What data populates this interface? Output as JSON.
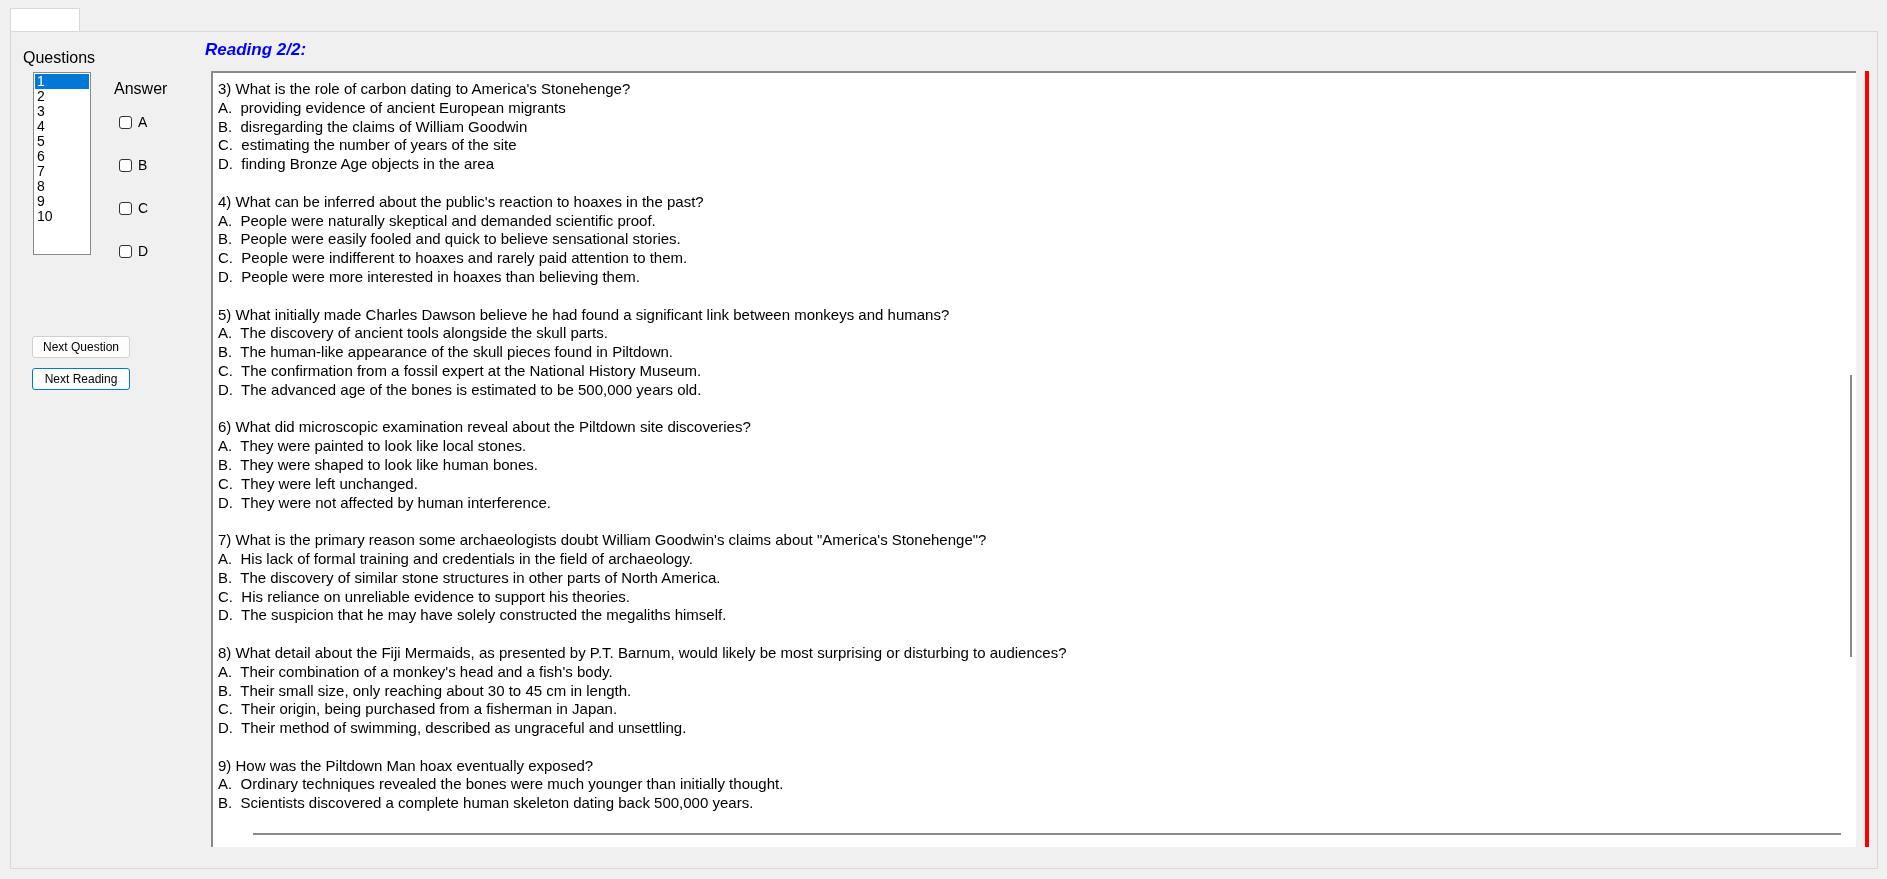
{
  "questions_label": "Questions",
  "question_list": [
    {
      "label": "1",
      "selected": true
    },
    {
      "label": "2",
      "selected": false
    },
    {
      "label": "3",
      "selected": false
    },
    {
      "label": "4",
      "selected": false
    },
    {
      "label": "5",
      "selected": false
    },
    {
      "label": "6",
      "selected": false
    },
    {
      "label": "7",
      "selected": false
    },
    {
      "label": "8",
      "selected": false
    },
    {
      "label": "9",
      "selected": false
    },
    {
      "label": "10",
      "selected": false
    }
  ],
  "answer_label": "Answer",
  "answer_options": [
    {
      "label": "A",
      "checked": false
    },
    {
      "label": "B",
      "checked": false
    },
    {
      "label": "C",
      "checked": false
    },
    {
      "label": "D",
      "checked": false
    }
  ],
  "buttons": [
    {
      "label": "Next Question",
      "focused": false
    },
    {
      "label": "Next Reading",
      "focused": true
    }
  ],
  "reading_title": "Reading 2/2:",
  "questions": [
    {
      "question": "3) What is the role of carbon dating to America's Stonehenge?",
      "options": [
        "A.  providing evidence of ancient European migrants",
        "B.  disregarding the claims of William Goodwin",
        "C.  estimating the number of years of the site",
        "D.  finding Bronze Age objects in the area"
      ]
    },
    {
      "question": "4) What can be inferred about the public's reaction to hoaxes in the past?",
      "options": [
        "A.  People were naturally skeptical and demanded scientific proof.",
        "B.  People were easily fooled and quick to believe sensational stories.",
        "C.  People were indifferent to hoaxes and rarely paid attention to them.",
        "D.  People were more interested in hoaxes than believing them."
      ]
    },
    {
      "question": "5) What initially made Charles Dawson believe he had found a significant link between monkeys and humans?",
      "options": [
        "A.  The discovery of ancient tools alongside the skull parts.",
        "B.  The human-like appearance of the skull pieces found in Piltdown.",
        "C.  The confirmation from a fossil expert at the National History Museum.",
        "D.  The advanced age of the bones is estimated to be 500,000 years old."
      ]
    },
    {
      "question": "6) What did microscopic examination reveal about the Piltdown site discoveries?",
      "options": [
        "A.  They were painted to look like local stones.",
        "B.  They were shaped to look like human bones.",
        "C.  They were left unchanged.",
        "D.  They were not affected by human interference."
      ]
    },
    {
      "question": "7) What is the primary reason some archaeologists doubt William Goodwin's claims about \"America's Stonehenge\"?",
      "options": [
        "A.  His lack of formal training and credentials in the field of archaeology.",
        "B.  The discovery of similar stone structures in other parts of North America.",
        "C.  His reliance on unreliable evidence to support his theories.",
        "D.  The suspicion that he may have solely constructed the megaliths himself."
      ]
    },
    {
      "question": "8) What detail about the Fiji Mermaids, as presented by P.T. Barnum, would likely be most surprising or disturbing to audiences?",
      "options": [
        "A.  Their combination of a monkey's head and a fish's body.",
        "B.  Their small size, only reaching about 30 to 45 cm in length.",
        "C.  Their origin, being purchased from a fisherman in Japan.",
        "D.  Their method of swimming, described as ungraceful and unsettling."
      ]
    },
    {
      "question": "9) How was the Piltdown Man hoax eventually exposed?",
      "options": [
        "A.  Ordinary techniques revealed the bones were much younger than initially thought.",
        "B.  Scientists discovered a complete human skeleton dating back 500,000 years."
      ]
    }
  ]
}
